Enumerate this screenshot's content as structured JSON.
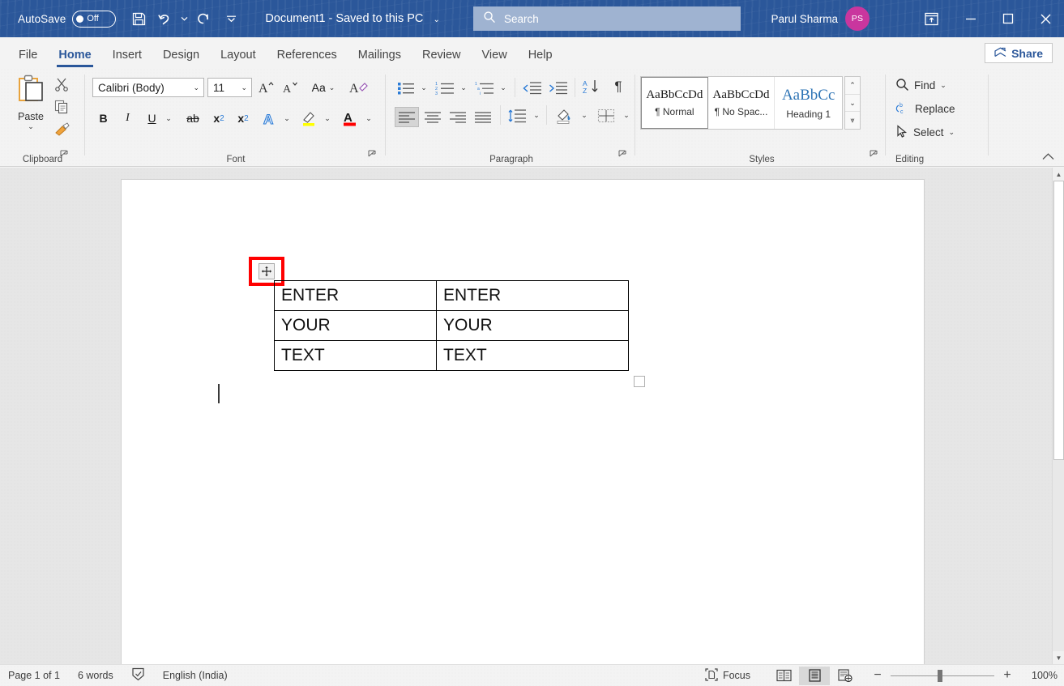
{
  "titlebar": {
    "autosave_label": "AutoSave",
    "autosave_state": "Off",
    "save_icon": "save-icon",
    "undo_icon": "undo-icon",
    "redo_icon": "redo-icon",
    "customize_icon": "customize-quick-access-icon",
    "document_title": "Document1",
    "save_status": "Saved to this PC",
    "title_separator": "-",
    "title_caret": "⌄",
    "account_name": "Parul Sharma",
    "account_initials": "PS",
    "ribbon_display_icon": "ribbon-display-options-icon",
    "minimize_icon": "minimize-icon",
    "maximize_icon": "maximize-icon",
    "close_icon": "close-icon"
  },
  "search": {
    "placeholder": "Search",
    "icon": "search-icon"
  },
  "tabs": [
    {
      "label": "File",
      "active": false
    },
    {
      "label": "Home",
      "active": true
    },
    {
      "label": "Insert",
      "active": false
    },
    {
      "label": "Design",
      "active": false
    },
    {
      "label": "Layout",
      "active": false
    },
    {
      "label": "References",
      "active": false
    },
    {
      "label": "Mailings",
      "active": false
    },
    {
      "label": "Review",
      "active": false
    },
    {
      "label": "View",
      "active": false
    },
    {
      "label": "Help",
      "active": false
    }
  ],
  "share": {
    "label": "Share",
    "icon": "share-icon"
  },
  "ribbon": {
    "collapse_icon": "collapse-ribbon-caret-icon",
    "groups": {
      "clipboard": {
        "label": "Clipboard",
        "paste_label": "Paste",
        "paste_icon": "paste-icon",
        "paste_caret": "⌄",
        "cut_icon": "cut-scissors-icon",
        "copy_icon": "copy-icon",
        "format_painter_icon": "format-painter-icon",
        "launcher_icon": "dialog-launcher-icon"
      },
      "font": {
        "label": "Font",
        "font_family": "Calibri (Body)",
        "font_size": "11",
        "grow_font_icon": "grow-font-icon",
        "shrink_font_icon": "shrink-font-icon",
        "change_case_icon": "change-case-icon",
        "clear_formatting_icon": "clear-all-formatting-icon",
        "bold_label": "B",
        "italic_label": "I",
        "underline_label": "U",
        "strikethrough_label": "ab",
        "subscript_label": "x",
        "subscript_sub": "2",
        "superscript_label": "x",
        "superscript_sup": "2",
        "text_effects_icon": "text-effects-icon",
        "highlight_icon": "text-highlight-color-icon",
        "font_color_icon": "font-color-icon",
        "launcher_icon": "dialog-launcher-icon"
      },
      "paragraph": {
        "label": "Paragraph",
        "bullets_icon": "bullets-icon",
        "numbering_icon": "numbering-icon",
        "multilevel_icon": "multilevel-list-icon",
        "decrease_indent_icon": "decrease-indent-icon",
        "increase_indent_icon": "increase-indent-icon",
        "sort_icon": "sort-az-icon",
        "formatting_marks_icon": "show-formatting-marks-icon",
        "align_left_icon": "align-left-icon",
        "align_center_icon": "align-center-icon",
        "align_right_icon": "align-right-icon",
        "justify_icon": "justify-icon",
        "line_spacing_icon": "line-and-paragraph-spacing-icon",
        "shading_icon": "shading-icon",
        "borders_icon": "borders-icon",
        "launcher_icon": "dialog-launcher-icon"
      },
      "styles": {
        "label": "Styles",
        "items": [
          {
            "preview": "AaBbCcDd",
            "name": "¶ Normal",
            "selected": true
          },
          {
            "preview": "AaBbCcDd",
            "name": "¶ No Spac...",
            "selected": false
          },
          {
            "preview": "AaBbCc",
            "name": "Heading 1",
            "selected": false
          }
        ],
        "scroll_up": "⌃",
        "scroll_down": "⌄",
        "scroll_more": "⩔",
        "launcher_icon": "dialog-launcher-icon"
      },
      "editing": {
        "label": "Editing",
        "find_label": "Find",
        "find_icon": "find-magnifier-icon",
        "find_caret": "⌄",
        "replace_label": "Replace",
        "replace_icon": "replace-icon",
        "select_label": "Select",
        "select_icon": "select-pointer-icon",
        "select_caret": "⌄"
      }
    }
  },
  "document": {
    "table_move_handle_icon": "table-move-handle-icon",
    "table": {
      "rows": [
        [
          "ENTER",
          "ENTER"
        ],
        [
          "YOUR",
          "YOUR"
        ],
        [
          "TEXT",
          "TEXT"
        ]
      ]
    },
    "end_of_table_mark": "end-of-row-mark",
    "highlight_color": "#ff0000"
  },
  "scrollbar": {
    "up_arrow": "▲",
    "down_arrow": "▼"
  },
  "statusbar": {
    "page_info": "Page 1 of 1",
    "word_count": "6 words",
    "proofing_icon": "proofing-errors-icon",
    "language": "English (India)",
    "focus_label": "Focus",
    "focus_icon": "focus-mode-icon",
    "read_mode_icon": "read-mode-icon",
    "print_layout_icon": "print-layout-icon",
    "web_layout_icon": "web-layout-icon",
    "zoom_out": "−",
    "zoom_in": "+",
    "zoom_level": "100%"
  },
  "colors": {
    "titlebar": "#2b579a",
    "accent": "#2b579a",
    "avatar": "#c9369e",
    "highlight": "#ff0000"
  }
}
